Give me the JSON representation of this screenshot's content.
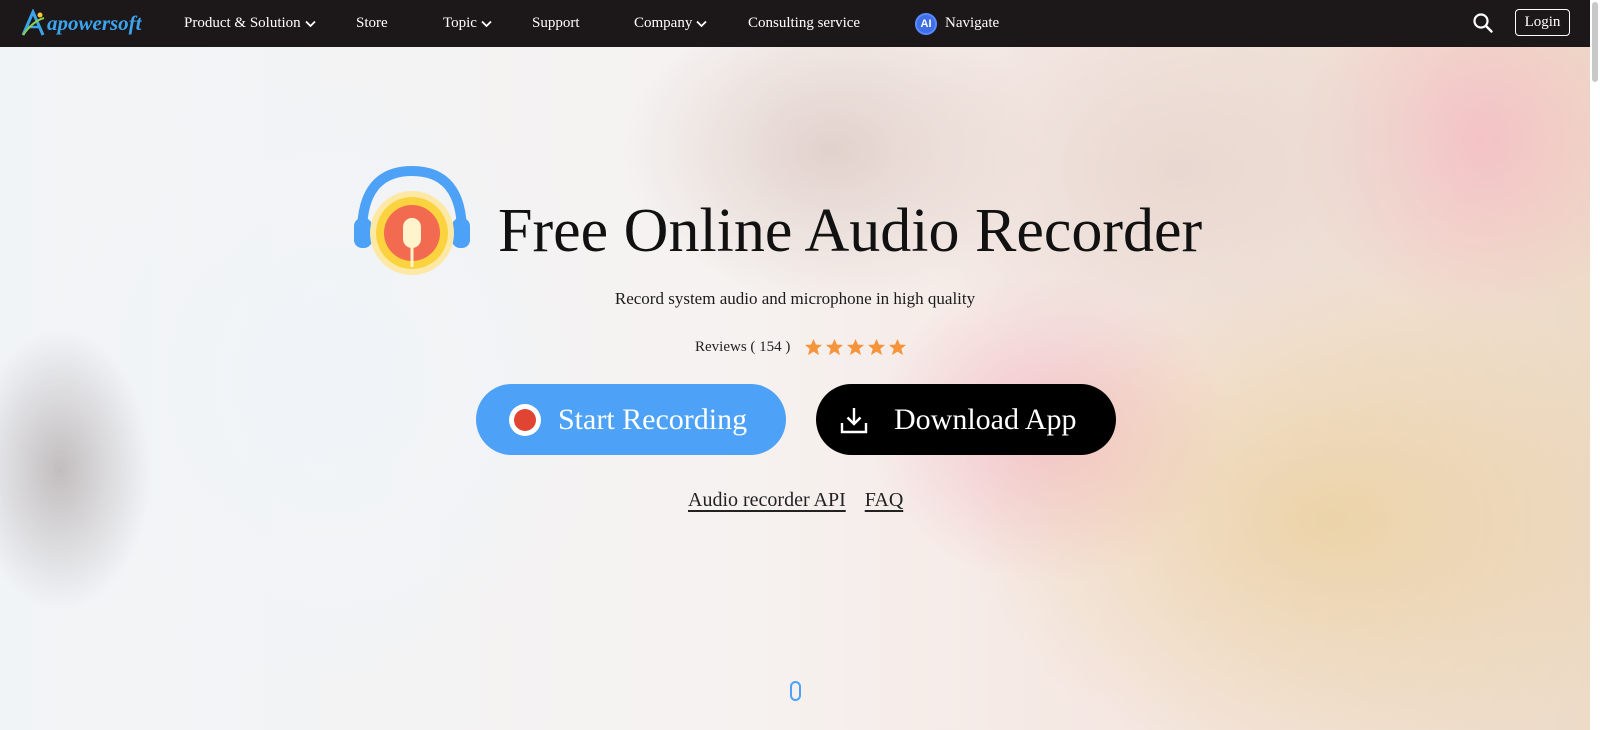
{
  "brand": {
    "logo_text": "apowersoft",
    "logo_letter": "A"
  },
  "nav": {
    "items": [
      {
        "label": "Product & Solution",
        "dropdown": true
      },
      {
        "label": "Store",
        "dropdown": false
      },
      {
        "label": "Topic",
        "dropdown": true
      },
      {
        "label": "Support",
        "dropdown": false
      },
      {
        "label": "Company",
        "dropdown": true
      },
      {
        "label": "Consulting service",
        "dropdown": false
      },
      {
        "label": "Navigate",
        "dropdown": false,
        "badge": "AI"
      }
    ],
    "search_icon": "search-icon",
    "login_label": "Login"
  },
  "hero": {
    "title": "Free Online Audio Recorder",
    "subtitle": "Record system audio and microphone in high quality",
    "reviews_label": "Reviews ( 154 )",
    "rating_stars": 5,
    "start_button": "Start Recording",
    "download_button": "Download App",
    "links": [
      "Audio recorder API",
      "FAQ"
    ]
  },
  "colors": {
    "nav_bg": "#1c1719",
    "brand_blue": "#3aa5ee",
    "start_button_bg": "#4da1f7",
    "download_button_bg": "#000000",
    "record_red": "#e04432",
    "star_orange": "#f5943a"
  }
}
